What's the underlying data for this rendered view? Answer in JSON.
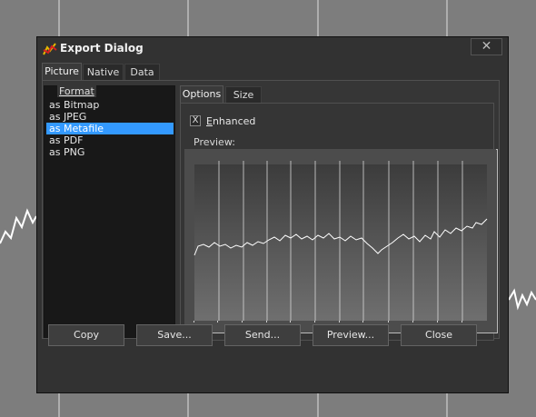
{
  "window": {
    "title": "Export Dialog",
    "close_glyph": "✕",
    "icon": "chart-app-icon"
  },
  "top_tabs": [
    {
      "label": "Picture",
      "active": true
    },
    {
      "label": "Native",
      "active": false
    },
    {
      "label": "Data",
      "active": false
    }
  ],
  "format": {
    "legend": "Format",
    "items": [
      "as Bitmap",
      "as JPEG",
      "as Metafile",
      "as PDF",
      "as PNG"
    ],
    "selected": "as Metafile"
  },
  "sub_tabs": [
    {
      "label": "Options",
      "active": true
    },
    {
      "label": "Size",
      "active": false
    }
  ],
  "options": {
    "enhanced_label": "Enhanced",
    "enhanced_checked": true,
    "check_glyph": "X",
    "preview_label": "Preview:"
  },
  "buttons": {
    "copy": "Copy",
    "save": "Save...",
    "send": "Send...",
    "preview": "Preview...",
    "close": "Close"
  }
}
